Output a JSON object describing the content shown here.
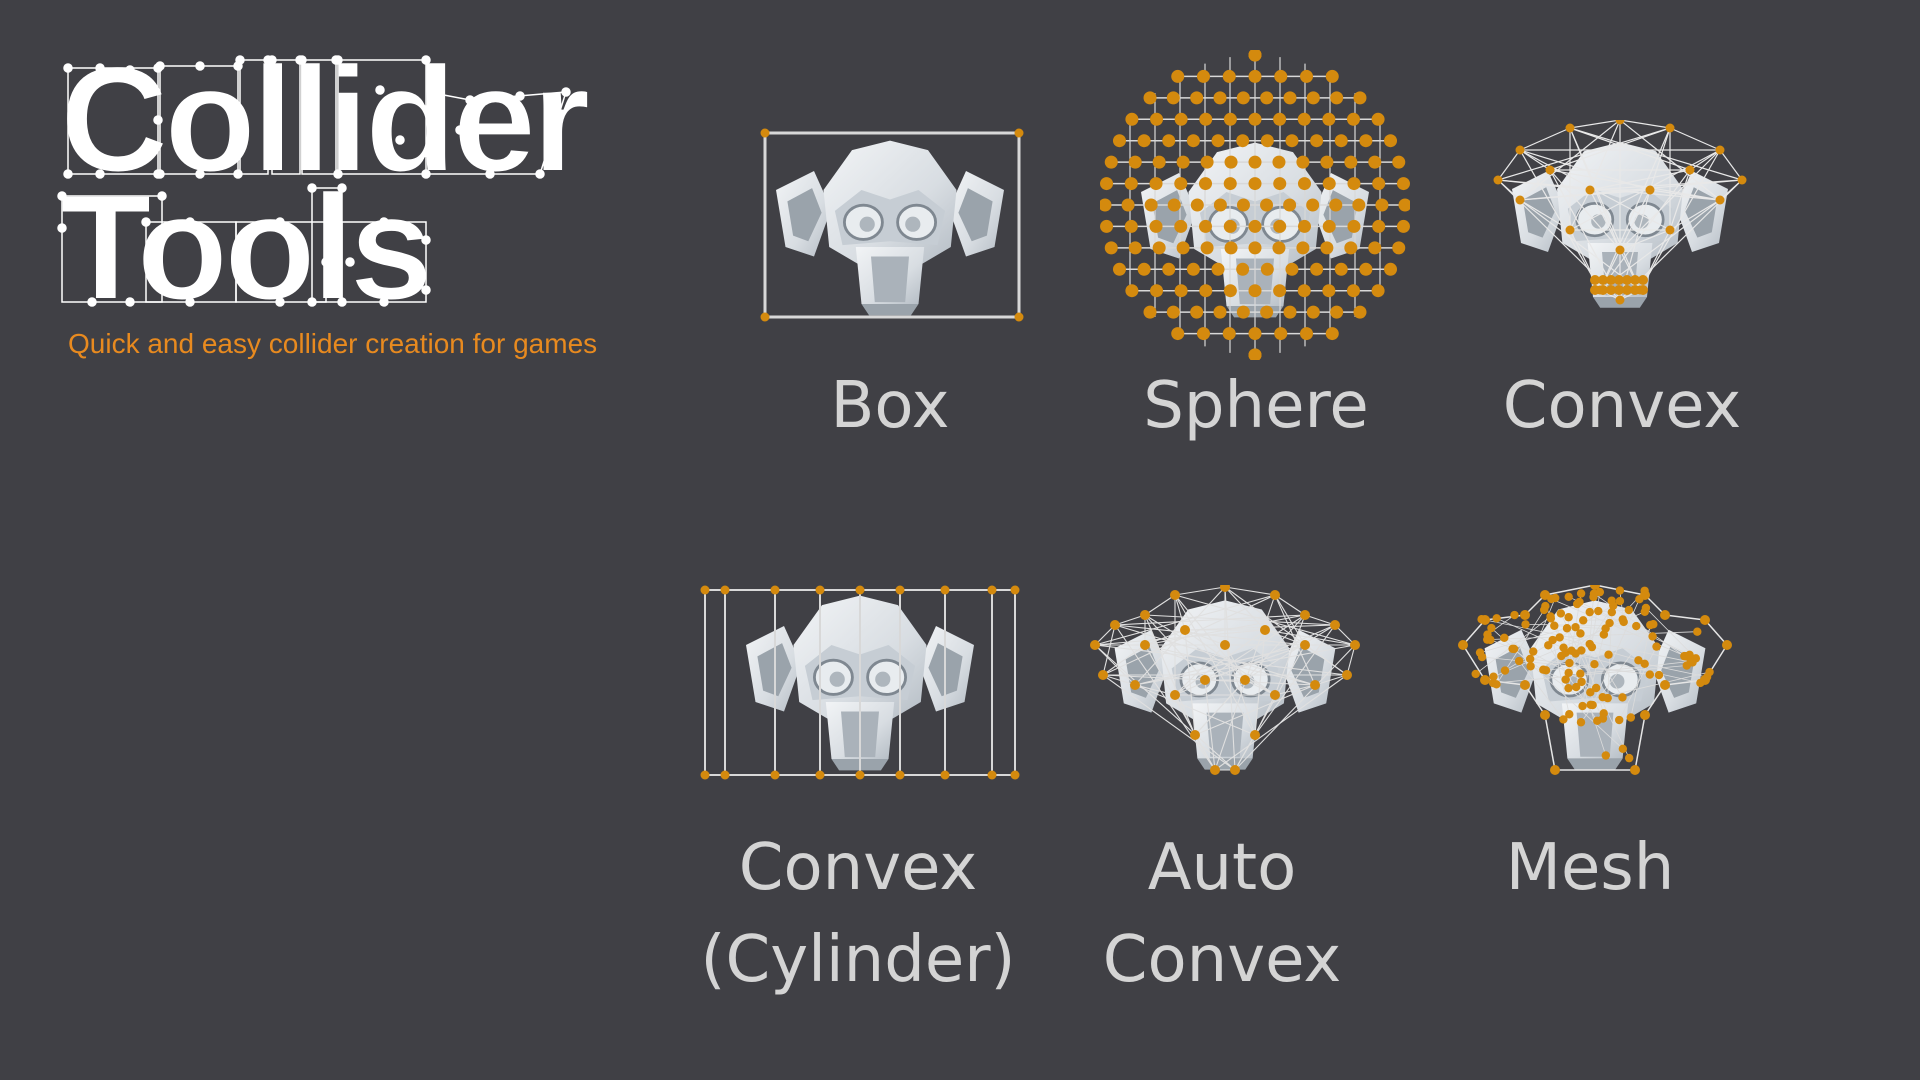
{
  "title": {
    "line1": "Collider",
    "line2": "Tools"
  },
  "tagline": "Quick and easy collider creation for games",
  "colors": {
    "background": "#404045",
    "accent": "#e88a1f",
    "vertex": "#d48a0e",
    "label": "#d4d4d4"
  },
  "colliders": [
    {
      "id": "box",
      "label_lines": [
        "Box"
      ],
      "icon": "monkey-head-box-collider"
    },
    {
      "id": "sphere",
      "label_lines": [
        "Sphere"
      ],
      "icon": "monkey-head-sphere-collider"
    },
    {
      "id": "convex",
      "label_lines": [
        "Convex"
      ],
      "icon": "monkey-head-convex-collider"
    },
    {
      "id": "convex-cylinder",
      "label_lines": [
        "Convex",
        "(Cylinder)"
      ],
      "icon": "monkey-head-cylinder-collider"
    },
    {
      "id": "auto-convex",
      "label_lines": [
        "Auto",
        "Convex"
      ],
      "icon": "monkey-head-auto-convex-collider"
    },
    {
      "id": "mesh",
      "label_lines": [
        "Mesh"
      ],
      "icon": "monkey-head-mesh-collider"
    }
  ]
}
